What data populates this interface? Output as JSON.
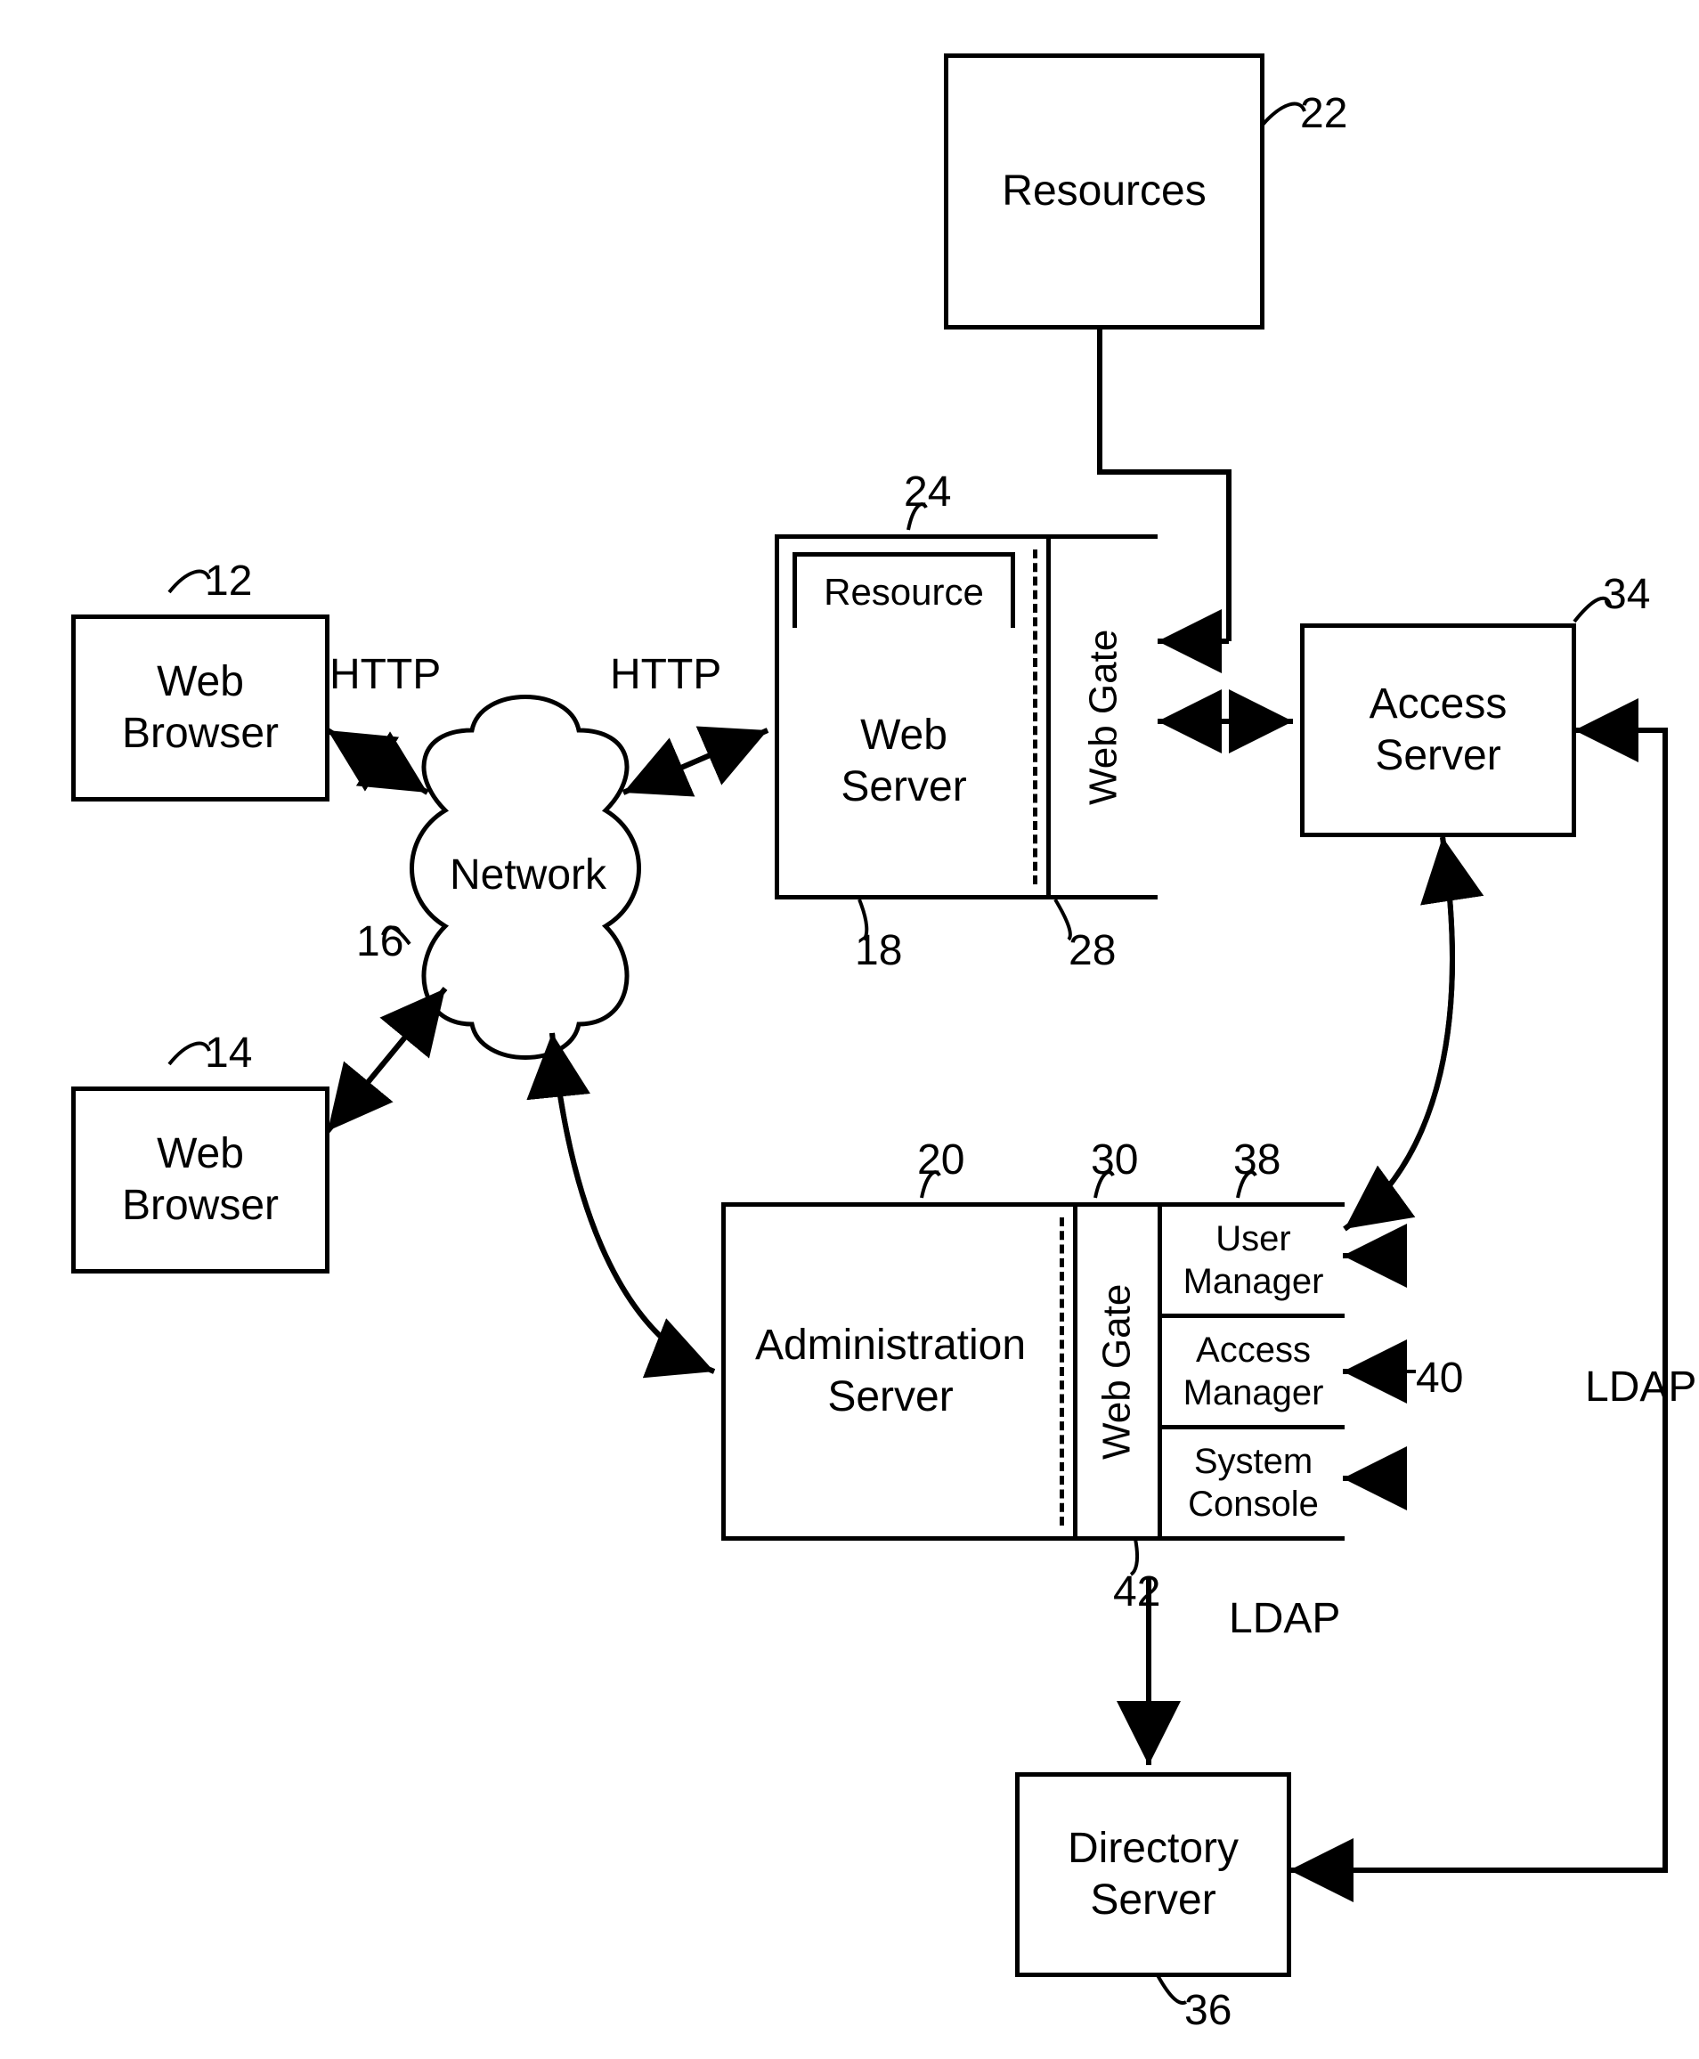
{
  "nodes": {
    "resources": {
      "label": "Resources",
      "ref": "22"
    },
    "browser1": {
      "label": "Web\nBrowser",
      "ref": "12"
    },
    "browser2": {
      "label": "Web\nBrowser",
      "ref": "14"
    },
    "network": {
      "label": "Network",
      "ref": "16"
    },
    "webserver": {
      "label": "Web\nServer",
      "ref": "18",
      "inner_resource": {
        "label": "Resource",
        "ref": "24"
      },
      "webgate": {
        "label": "Web Gate",
        "ref": "28"
      }
    },
    "access": {
      "label": "Access\nServer",
      "ref": "34"
    },
    "admin": {
      "label": "Administration\nServer",
      "ref": "20",
      "webgate": {
        "label": "Web Gate",
        "ref": "30"
      },
      "stack": {
        "user_manager": {
          "label": "User\nManager",
          "ref": "38"
        },
        "access_manager": {
          "label": "Access\nManager",
          "ref": "40"
        },
        "system_console": {
          "label": "System\nConsole",
          "ref": "42"
        }
      }
    },
    "directory": {
      "label": "Directory\nServer",
      "ref": "36"
    }
  },
  "edges": {
    "http1": "HTTP",
    "http2": "HTTP",
    "ldap1": "LDAP",
    "ldap2": "LDAP"
  }
}
